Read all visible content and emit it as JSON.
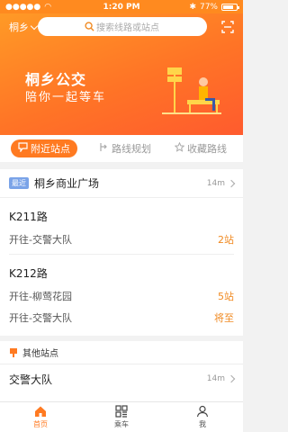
{
  "status_bar": {
    "time": "1:20 PM",
    "battery": "77%",
    "battery_fill": 0.77
  },
  "header": {
    "city": "桐乡",
    "search_placeholder": "搜索线路或站点"
  },
  "banner": {
    "title": "桐乡公交",
    "subtitle": "陪你一起等车"
  },
  "tabs": [
    {
      "label": "附近站点",
      "icon": "chat-bubble-icon",
      "active": true
    },
    {
      "label": "路线规划",
      "icon": "route-icon",
      "active": false
    },
    {
      "label": "收藏路线",
      "icon": "star-icon",
      "active": false
    }
  ],
  "nearby": {
    "badge": "最近",
    "station": "桐乡商业广场",
    "distance": "14m"
  },
  "routes": [
    {
      "name": "K211路",
      "lines": [
        {
          "text": "开往-交警大队",
          "status": "2站"
        }
      ]
    },
    {
      "name": "K212路",
      "lines": [
        {
          "text": "开往-柳莺花园",
          "status": "5站"
        },
        {
          "text": "开往-交警大队",
          "status": "将至"
        }
      ]
    }
  ],
  "other_stations": {
    "heading": "其他站点",
    "items": [
      {
        "name": "交警大队",
        "distance": "14m"
      }
    ]
  },
  "tabbar": [
    {
      "label": "首页",
      "icon": "home-icon",
      "active": true
    },
    {
      "label": "乘车",
      "icon": "grid-icon",
      "active": false
    },
    {
      "label": "我",
      "icon": "person-icon",
      "active": false
    }
  ],
  "colors": {
    "accent": "#ff7a21",
    "badge": "#7aa3e8",
    "text_orange": "#f08a22"
  }
}
